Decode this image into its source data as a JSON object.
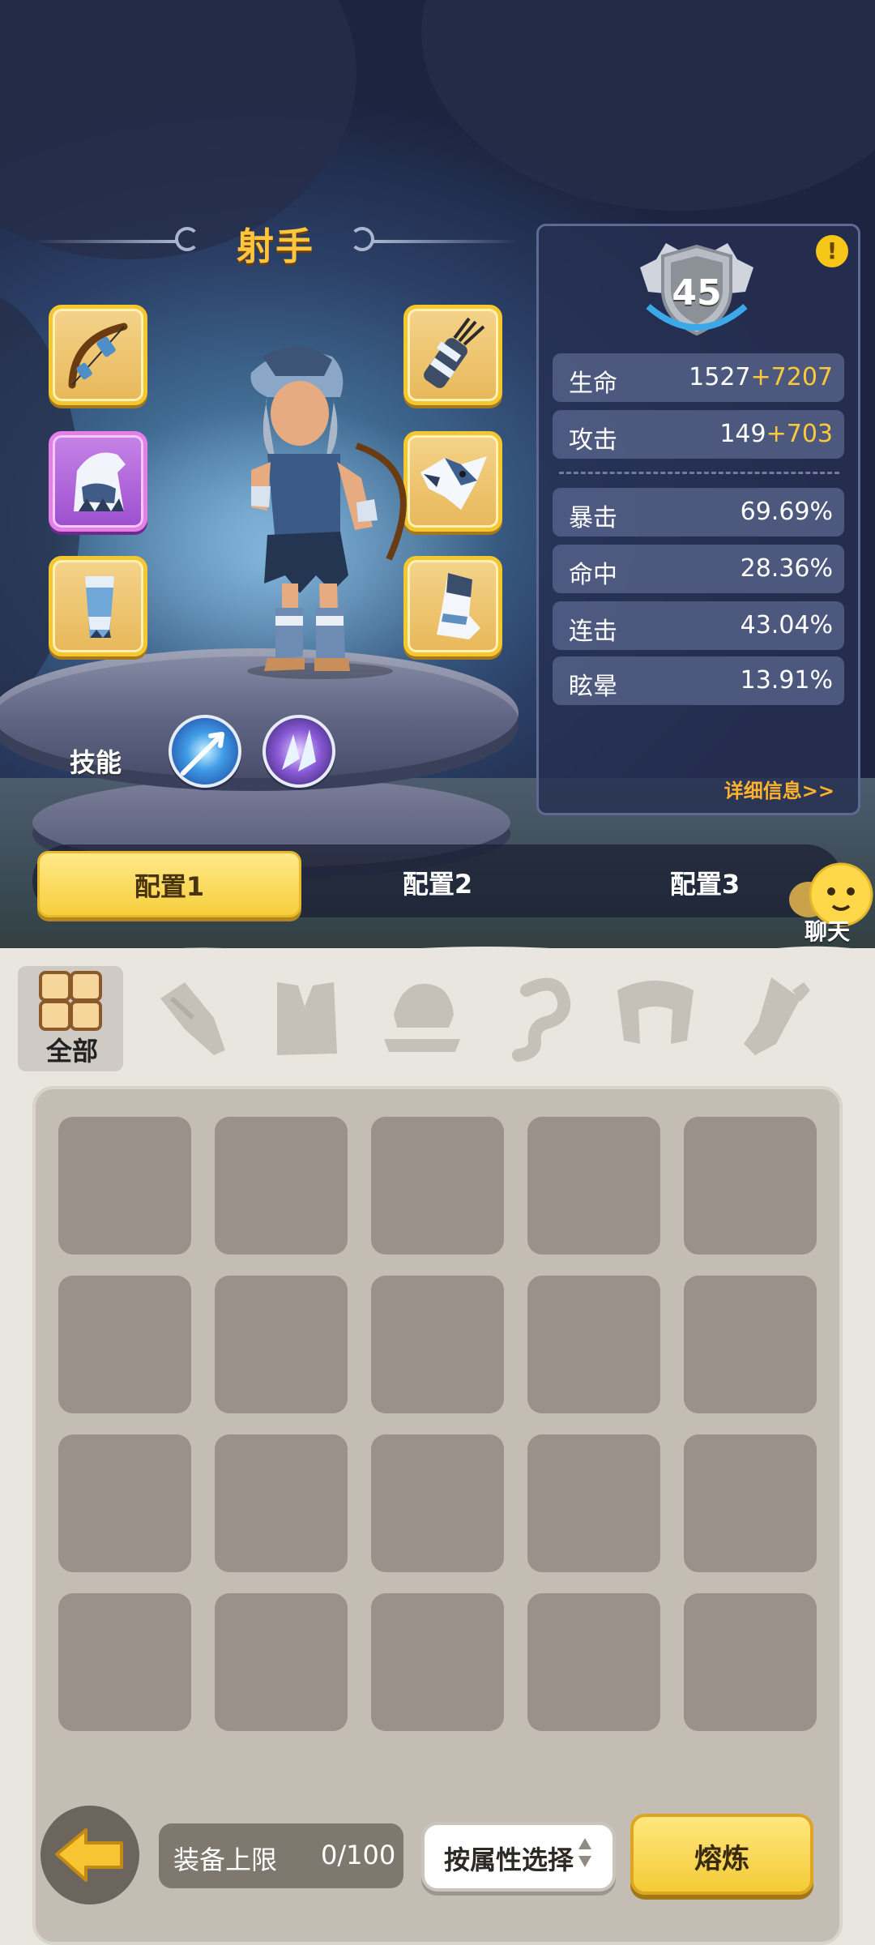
{
  "character": {
    "class_name": "射手",
    "level": "45"
  },
  "equipment_slots": [
    {
      "slot": "weapon",
      "icon": "bow-icon"
    },
    {
      "slot": "quiver",
      "icon": "quiver-icon"
    },
    {
      "slot": "head",
      "icon": "wolf-hood-icon",
      "rarity": "epic"
    },
    {
      "slot": "necklace",
      "icon": "wolf-head-icon"
    },
    {
      "slot": "bracer",
      "icon": "bracer-icon"
    },
    {
      "slot": "boots",
      "icon": "boots-icon"
    }
  ],
  "skills": {
    "label": "技能",
    "items": [
      {
        "icon": "lightning-arrow-skill-icon"
      },
      {
        "icon": "crystal-shard-skill-icon"
      }
    ]
  },
  "stats": {
    "hp": {
      "label": "生命",
      "base": "1527",
      "bonus": "+7207"
    },
    "atk": {
      "label": "攻击",
      "base": "149",
      "bonus": "+703"
    },
    "crit": {
      "label": "暴击",
      "value": "69.69%"
    },
    "hit": {
      "label": "命中",
      "value": "28.36%"
    },
    "combo": {
      "label": "连击",
      "value": "43.04%"
    },
    "stun": {
      "label": "眩晕",
      "value": "13.91%"
    },
    "detail_link": "详细信息>>"
  },
  "config_tabs": [
    {
      "label": "配置1",
      "active": true
    },
    {
      "label": "配置2",
      "active": false
    },
    {
      "label": "配置3",
      "active": false
    }
  ],
  "chat": {
    "label": "聊天"
  },
  "categories": [
    {
      "label": "全部",
      "icon": "grid-icon",
      "active": true
    },
    {
      "icon": "weapon-category-icon"
    },
    {
      "icon": "armor-category-icon"
    },
    {
      "icon": "helmet-category-icon"
    },
    {
      "icon": "necklace-category-icon"
    },
    {
      "icon": "bracer-category-icon"
    },
    {
      "icon": "boots-category-icon"
    }
  ],
  "inventory": {
    "empty_slots": 20
  },
  "bottom": {
    "limit_label": "装备上限",
    "limit_value": "0/100",
    "filter_label": "按属性选择",
    "smelt_label": "熔炼"
  },
  "colors": {
    "accent_gold": "#f6cf3c",
    "bonus_text": "#ffc93a",
    "epic_purple": "#c783e6"
  }
}
